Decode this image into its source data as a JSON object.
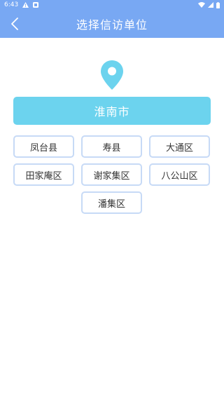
{
  "status_bar": {
    "time": "6:43"
  },
  "header": {
    "title": "选择信访单位"
  },
  "city": {
    "name": "淮南市"
  },
  "districts": [
    "凤台县",
    "寿县",
    "大通区",
    "田家庵区",
    "谢家集区",
    "八公山区",
    "潘集区"
  ],
  "colors": {
    "header": "#78a8f3",
    "banner": "#6cd3ee",
    "pin": "#6cd3ee",
    "button_border": "#c7daf6"
  },
  "icons": [
    "warning-icon",
    "notification-icon",
    "wifi-icon",
    "signal-icon",
    "battery-icon",
    "back-arrow-icon",
    "location-pin-icon"
  ]
}
